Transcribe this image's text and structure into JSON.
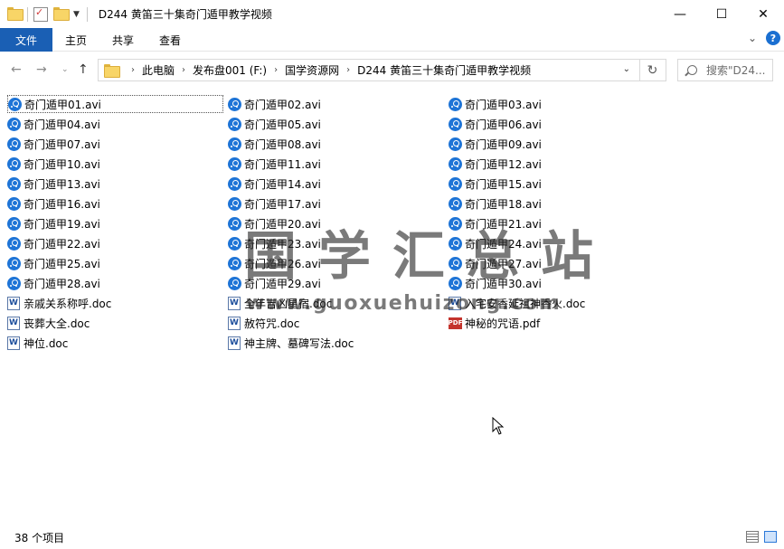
{
  "titlebar": {
    "title": "D244 黄笛三十集奇门遁甲教学视频",
    "minimize": "—",
    "maximize": "☐",
    "close": "✕"
  },
  "ribbon": {
    "tabs": [
      "文件",
      "主页",
      "共享",
      "查看"
    ],
    "collapse_icon": "chevron-up",
    "help_label": "?"
  },
  "address": {
    "breadcrumbs": [
      "此电脑",
      "发布盘001 (F:)",
      "国学资源网",
      "D244 黄笛三十集奇门遁甲教学视频"
    ],
    "search_placeholder": "搜索\"D24..."
  },
  "files": {
    "col1": [
      {
        "name": "奇门遁甲01.avi",
        "type": "avi",
        "selected": true
      },
      {
        "name": "奇门遁甲04.avi",
        "type": "avi"
      },
      {
        "name": "奇门遁甲07.avi",
        "type": "avi"
      },
      {
        "name": "奇门遁甲10.avi",
        "type": "avi"
      },
      {
        "name": "奇门遁甲13.avi",
        "type": "avi"
      },
      {
        "name": "奇门遁甲16.avi",
        "type": "avi"
      },
      {
        "name": "奇门遁甲19.avi",
        "type": "avi"
      },
      {
        "name": "奇门遁甲22.avi",
        "type": "avi"
      },
      {
        "name": "奇门遁甲25.avi",
        "type": "avi"
      },
      {
        "name": "奇门遁甲28.avi",
        "type": "avi"
      },
      {
        "name": "亲戚关系称呼.doc",
        "type": "doc"
      },
      {
        "name": "丧葬大全.doc",
        "type": "doc"
      },
      {
        "name": "神位.doc",
        "type": "doc"
      }
    ],
    "col2": [
      {
        "name": "奇门遁甲02.avi",
        "type": "avi"
      },
      {
        "name": "奇门遁甲05.avi",
        "type": "avi"
      },
      {
        "name": "奇门遁甲08.avi",
        "type": "avi"
      },
      {
        "name": "奇门遁甲11.avi",
        "type": "avi"
      },
      {
        "name": "奇门遁甲14.avi",
        "type": "avi"
      },
      {
        "name": "奇门遁甲17.avi",
        "type": "avi"
      },
      {
        "name": "奇门遁甲20.avi",
        "type": "avi"
      },
      {
        "name": "奇门遁甲23.avi",
        "type": "avi"
      },
      {
        "name": "奇门遁甲26.avi",
        "type": "avi"
      },
      {
        "name": "奇门遁甲29.avi",
        "type": "avi"
      },
      {
        "name": "全年吉凶星宿.doc",
        "type": "doc"
      },
      {
        "name": "赦符咒.doc",
        "type": "doc"
      },
      {
        "name": "神主牌、墓碑写法.doc",
        "type": "doc"
      }
    ],
    "col3": [
      {
        "name": "奇门遁甲03.avi",
        "type": "avi"
      },
      {
        "name": "奇门遁甲06.avi",
        "type": "avi"
      },
      {
        "name": "奇门遁甲09.avi",
        "type": "avi"
      },
      {
        "name": "奇门遁甲12.avi",
        "type": "avi"
      },
      {
        "name": "奇门遁甲15.avi",
        "type": "avi"
      },
      {
        "name": "奇门遁甲18.avi",
        "type": "avi"
      },
      {
        "name": "奇门遁甲21.avi",
        "type": "avi"
      },
      {
        "name": "奇门遁甲24.avi",
        "type": "avi"
      },
      {
        "name": "奇门遁甲27.avi",
        "type": "avi"
      },
      {
        "name": "奇门遁甲30.avi",
        "type": "avi"
      },
      {
        "name": "入宅安香延祖神香火.doc",
        "type": "doc"
      },
      {
        "name": "神秘的咒语.pdf",
        "type": "pdf"
      }
    ]
  },
  "watermark": {
    "title": "国学汇总站",
    "url": "www.guoxuehuizong.com"
  },
  "status": {
    "item_count": "38 个项目"
  }
}
